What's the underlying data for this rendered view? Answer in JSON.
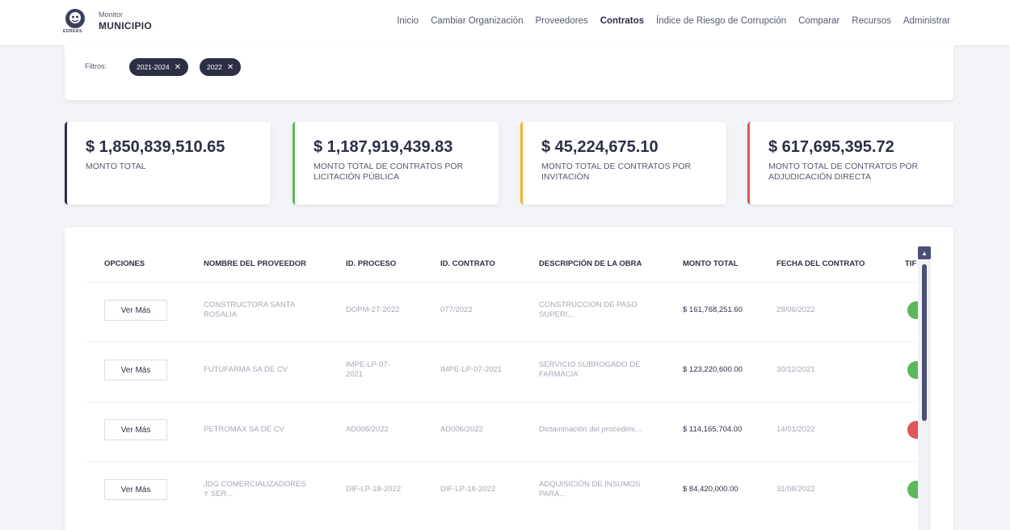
{
  "brand": {
    "small": "Monitor",
    "big": "MUNICIPIO",
    "logo_sub": "EDRERS"
  },
  "nav": [
    "Inicio",
    "Cambiar Organización",
    "Proveedores",
    "Contratos",
    "Índice de Riesgo de Corrupción",
    "Comparar",
    "Recursos",
    "Administrar"
  ],
  "nav_active": "Contratos",
  "filters": {
    "label": "Filtros:",
    "chips": [
      "2021-2024",
      "2022"
    ]
  },
  "stats": [
    {
      "amount": "$ 1,850,839,510.65",
      "desc": "MONTO TOTAL",
      "color": "#2c2f45"
    },
    {
      "amount": "$ 1,187,919,439.83",
      "desc": "MONTO TOTAL DE CONTRATOS POR LICITACIÓN PÚBLICA",
      "color": "#5cb85c"
    },
    {
      "amount": "$ 45,224,675.10",
      "desc": "MONTO TOTAL DE CONTRATOS POR INVITACIÓN",
      "color": "#f0b429"
    },
    {
      "amount": "$ 617,695,395.72",
      "desc": "MONTO TOTAL DE CONTRATOS POR ADJUDICACIÓN DIRECTA",
      "color": "#e05555"
    }
  ],
  "table": {
    "headers": [
      "OPCIONES",
      "NOMBRE DEL PROVEEDOR",
      "ID. PROCESO",
      "ID. CONTRATO",
      "DESCRIPCIÓN DE LA OBRA",
      "MONTO TOTAL",
      "FECHA DEL CONTRATO",
      "TIF"
    ],
    "button_label": "Ver Más",
    "rows": [
      {
        "proveedor": "CONSTRUCTORA SANTA ROSALIA",
        "proceso": "DOPM-27-2022",
        "contrato": "077/2022",
        "descripcion": "CONSTRUCCION DE PASO SUPERI...",
        "monto": "$ 161,768,251.60",
        "fecha": "29/06/2022",
        "status_color": "#5cb85c"
      },
      {
        "proveedor": "FUTUFARMA SA DE CV",
        "proceso": "IMPE-LP-07-2021",
        "contrato": "IMPE-LP-07-2021",
        "descripcion": "SERVICIO SUBROGADO DE FARMACIA",
        "monto": "$ 123,220,600.00",
        "fecha": "30/12/2021",
        "status_color": "#5cb85c"
      },
      {
        "proveedor": "PETROMAX SA DE CV",
        "proceso": "AD006/2022",
        "contrato": "AD006/2022",
        "descripcion": "Dictaminación del procedimi...",
        "monto": "$ 114,165,704.00",
        "fecha": "14/01/2022",
        "status_color": "#e05555"
      },
      {
        "proveedor": "JDG COMERCIALIZADORES Y SER...",
        "proceso": "DIF-LP-18-2022",
        "contrato": "DIF-LP-18-2022",
        "descripcion": "ADQUISICIÓN DE INSUMOS PARA...",
        "monto": "$ 84,420,000.00",
        "fecha": "31/08/2022",
        "status_color": "#5cb85c"
      }
    ]
  }
}
